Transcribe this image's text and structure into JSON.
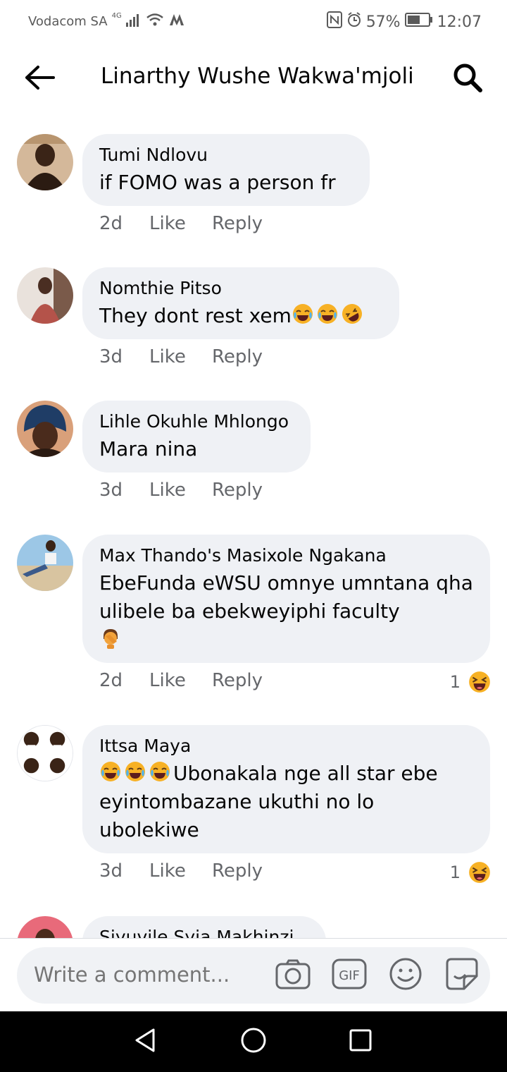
{
  "status_bar": {
    "carrier": "Vodacom SA",
    "network": "4G",
    "battery": "57%",
    "time": "12:07"
  },
  "header": {
    "title": "Linarthy Wushe Wakwa'mjoli",
    "icons": [
      "arrow-left-icon",
      "search-icon"
    ]
  },
  "comments": [
    {
      "author": "Tumi Ndlovu",
      "text": "if FOMO was a person fr",
      "time": "2d",
      "like_label": "Like",
      "reply_label": "Reply"
    },
    {
      "author": "Nomthie Pitso",
      "text": "They dont rest xem",
      "emoji_suffix": [
        "joy",
        "joy",
        "rofl"
      ],
      "time": "3d",
      "like_label": "Like",
      "reply_label": "Reply"
    },
    {
      "author": "Lihle Okuhle Mhlongo",
      "text": "Mara nina",
      "time": "3d",
      "like_label": "Like",
      "reply_label": "Reply"
    },
    {
      "author": "Max Thando's Masixole Ngakana",
      "text": "EbeFunda eWSU omnye umntana qha ulibele ba ebekweyiphi faculty",
      "emoji_suffix": [
        "facepalm"
      ],
      "time": "2d",
      "like_label": "Like",
      "reply_label": "Reply",
      "reaction_count": "1",
      "reaction": "haha"
    },
    {
      "author": "Ittsa Maya",
      "emoji_prefix": [
        "joy",
        "joy",
        "joy"
      ],
      "text": "Ubonakala nge all star ebe eyintombazane ukuthi no lo ubolekiwe",
      "time": "3d",
      "like_label": "Like",
      "reply_label": "Reply",
      "reaction_count": "1",
      "reaction": "haha"
    },
    {
      "author": "Siyuvile Syia Makhinzi"
    }
  ],
  "composer": {
    "placeholder": "Write a comment...",
    "icons": [
      "camera-icon",
      "gif-icon",
      "emoji-icon",
      "sticker-icon"
    ]
  },
  "colors": {
    "bubble": "#eff1f5",
    "meta": "#65676b",
    "emoji_yellow": "#f7b125"
  }
}
